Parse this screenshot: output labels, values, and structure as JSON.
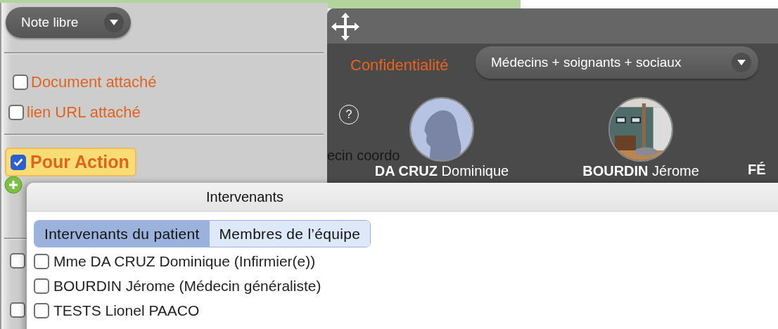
{
  "note_panel": {
    "type_select": {
      "value": "Note libre"
    },
    "attachments": [
      {
        "label": "Document attaché",
        "checked": false
      },
      {
        "label": "lien URL attaché",
        "checked": false
      }
    ],
    "action": {
      "label": "Pour Action",
      "checked": true
    },
    "lower_checkboxes": [
      {
        "checked": false
      },
      {
        "checked": false
      }
    ]
  },
  "sharing_panel": {
    "background_text": "ecin coordo",
    "confidentiality": {
      "label": "Confidentialité",
      "value": "Médecins + soignants + sociaux"
    },
    "help": "?",
    "members": [
      {
        "last_name": "DA CRUZ",
        "first_name": "Dominique",
        "kind": "silhouette"
      },
      {
        "last_name": "BOURDIN",
        "first_name": "Jérome",
        "kind": "picture"
      },
      {
        "last_name": "FÉ",
        "kind": "name_only"
      }
    ]
  },
  "dialog": {
    "title": "Intervenants",
    "tabs": [
      {
        "label": "Intervenants du patient",
        "selected": true
      },
      {
        "label": "Membres de l’équipe",
        "selected": false
      }
    ],
    "people": [
      {
        "label": "Mme DA CRUZ Dominique (Infirmier(e))",
        "checked": false
      },
      {
        "label": "BOURDIN Jérome (Médecin généraliste)",
        "checked": false
      },
      {
        "label": "TESTS Lionel PAACO",
        "checked": false
      }
    ]
  }
}
